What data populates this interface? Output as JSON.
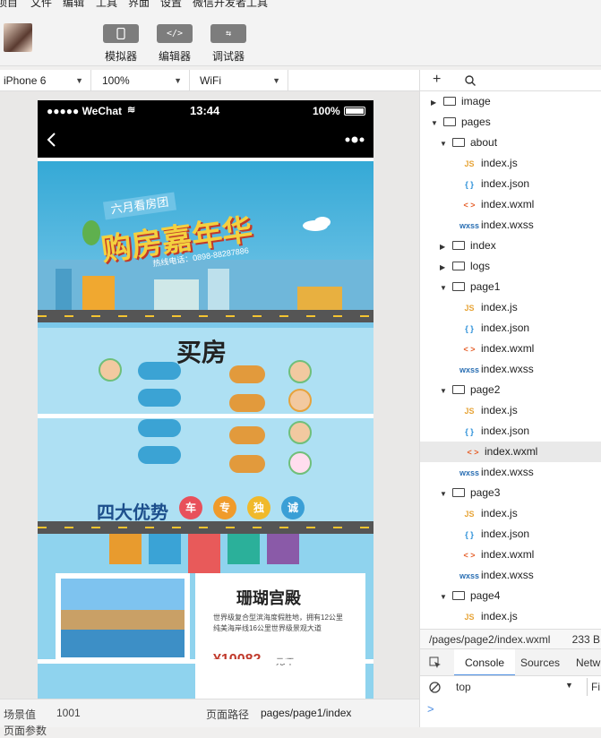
{
  "menu": [
    "项目",
    "文件",
    "编辑",
    "工具",
    "界面",
    "设置",
    "微信开发者工具"
  ],
  "toolbar": {
    "simulator": "模拟器",
    "editor": "编辑器",
    "debugger": "调试器",
    "editor_icon": "</>"
  },
  "device_bar": {
    "device": "iPhone 6",
    "zoom": "100%",
    "network": "WiFi"
  },
  "phone": {
    "carrier": "●●●●● WeChat",
    "time": "13:44",
    "battery": "100%",
    "banner_title": "购房嘉年华",
    "banner_subtitle": "六月看房团",
    "banner_phone": "热线电话：0898-88287886",
    "buy_title": "买房",
    "advantages": "四大优势",
    "adv_chars": [
      "车",
      "专",
      "独",
      "诚"
    ],
    "resort_name": "珊瑚宫殿",
    "price": "¥10082",
    "price_unit": "元/平",
    "resort_desc": "世界级复合型滨海度假胜地，拥有12公里纯美海岸线16公里世界级景观大道"
  },
  "file_tree": [
    {
      "name": "image",
      "type": "folder",
      "depth": 1,
      "open": false
    },
    {
      "name": "pages",
      "type": "folder",
      "depth": 1,
      "open": true
    },
    {
      "name": "about",
      "type": "folder",
      "depth": 2,
      "open": true
    },
    {
      "name": "index.js",
      "type": "js",
      "depth": 3
    },
    {
      "name": "index.json",
      "type": "json",
      "depth": 3
    },
    {
      "name": "index.wxml",
      "type": "wxml",
      "depth": 3
    },
    {
      "name": "index.wxss",
      "type": "wxss",
      "depth": 3
    },
    {
      "name": "index",
      "type": "folder",
      "depth": 2,
      "open": false
    },
    {
      "name": "logs",
      "type": "folder",
      "depth": 2,
      "open": false
    },
    {
      "name": "page1",
      "type": "folder",
      "depth": 2,
      "open": true
    },
    {
      "name": "index.js",
      "type": "js",
      "depth": 3
    },
    {
      "name": "index.json",
      "type": "json",
      "depth": 3
    },
    {
      "name": "index.wxml",
      "type": "wxml",
      "depth": 3
    },
    {
      "name": "index.wxss",
      "type": "wxss",
      "depth": 3
    },
    {
      "name": "page2",
      "type": "folder",
      "depth": 2,
      "open": true
    },
    {
      "name": "index.js",
      "type": "js",
      "depth": 3
    },
    {
      "name": "index.json",
      "type": "json",
      "depth": 3
    },
    {
      "name": "index.wxml",
      "type": "wxml",
      "depth": 3,
      "selected": true
    },
    {
      "name": "index.wxss",
      "type": "wxss",
      "depth": 3
    },
    {
      "name": "page3",
      "type": "folder",
      "depth": 2,
      "open": true
    },
    {
      "name": "index.js",
      "type": "js",
      "depth": 3
    },
    {
      "name": "index.json",
      "type": "json",
      "depth": 3
    },
    {
      "name": "index.wxml",
      "type": "wxml",
      "depth": 3
    },
    {
      "name": "index.wxss",
      "type": "wxss",
      "depth": 3
    },
    {
      "name": "page4",
      "type": "folder",
      "depth": 2,
      "open": true
    },
    {
      "name": "index.js",
      "type": "js",
      "depth": 3
    }
  ],
  "file_type_labels": {
    "js": "JS",
    "json": "{ }",
    "wxml": "< >",
    "wxss": "wxss"
  },
  "file_type_colors": {
    "js": "#e7a437",
    "json": "#2a8fd8",
    "wxml": "#e6612c",
    "wxss": "#2a6fb3"
  },
  "path_bar": {
    "path": "/pages/page2/index.wxml",
    "size": "233 B"
  },
  "console": {
    "tab_console": "Console",
    "tab_sources": "Sources",
    "tab_network": "Netw",
    "context": "top",
    "filter": "Fi",
    "prompt": ">"
  },
  "bottom_bar": {
    "scene_label": "场景值",
    "scene_value": "1001",
    "path_label": "页面路径",
    "path_value": "pages/page1/index",
    "params_label": "页面参数"
  }
}
